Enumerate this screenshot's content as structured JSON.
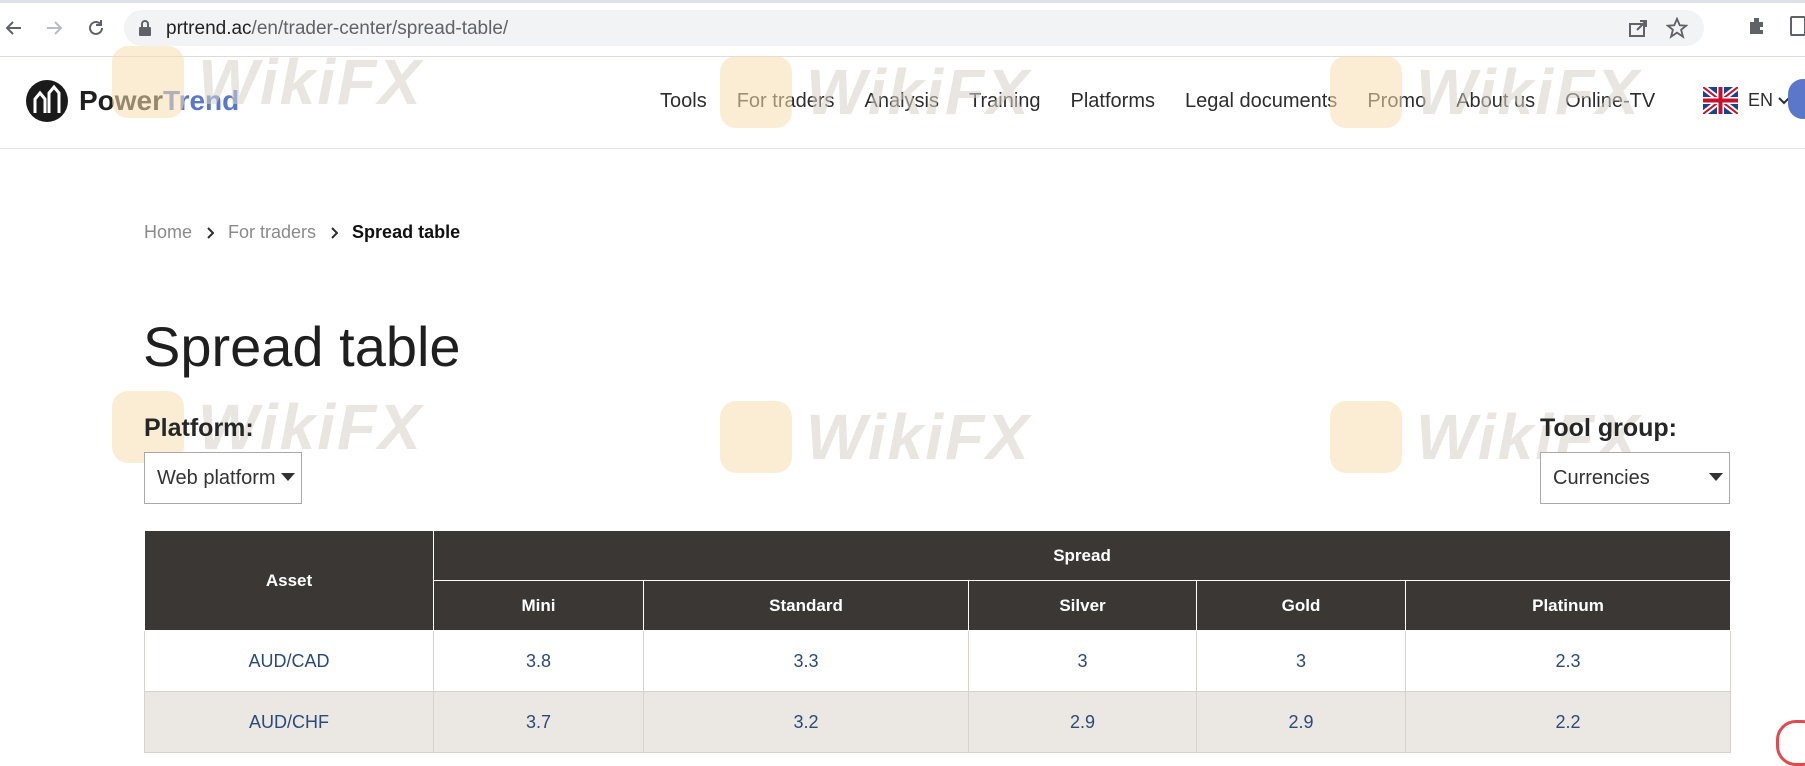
{
  "browser": {
    "url_host": "prtrend.ac",
    "url_path": "/en/trader-center/spread-table/"
  },
  "header": {
    "logo_text_1": "Power",
    "logo_text_2": "Trend",
    "nav": [
      "Tools",
      "For traders",
      "Analysis",
      "Training",
      "Platforms",
      "Legal documents",
      "Promo",
      "About us",
      "Online-TV"
    ],
    "language": "EN"
  },
  "breadcrumb": {
    "home": "Home",
    "section": "For traders",
    "current": "Spread table"
  },
  "page": {
    "title": "Spread table",
    "platform_label": "Platform:",
    "platform_value": "Web platform",
    "group_label": "Tool group:",
    "group_value": "Currencies"
  },
  "table": {
    "asset_header": "Asset",
    "spread_header": "Spread",
    "columns": [
      "Mini",
      "Standard",
      "Silver",
      "Gold",
      "Platinum"
    ],
    "rows": [
      {
        "asset": "AUD/CAD",
        "values": [
          "3.8",
          "3.3",
          "3",
          "3",
          "2.3"
        ]
      },
      {
        "asset": "AUD/CHF",
        "values": [
          "3.7",
          "3.2",
          "2.9",
          "2.9",
          "2.2"
        ]
      }
    ]
  },
  "watermark": "WikiFX",
  "colors": {
    "table_header": "#3a3734",
    "brand_blue": "#5b77c9",
    "alt_row": "#ebe8e3",
    "cell_text": "#2a4a7a"
  }
}
